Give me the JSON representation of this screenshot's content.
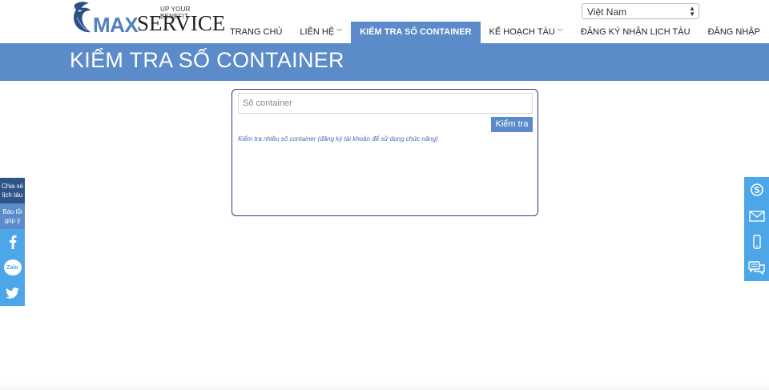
{
  "header": {
    "logo": {
      "tagline": "UP YOUR BENEFIT",
      "brand_max": "MAX",
      "brand_service": "SERVICE"
    },
    "language": {
      "selected": "Việt Nam"
    },
    "nav": [
      {
        "label": "TRANG CHỦ",
        "active": false,
        "dropdown": false
      },
      {
        "label": "LIÊN HỆ",
        "active": false,
        "dropdown": true
      },
      {
        "label": "KIỂM TRA SỐ CONTAINER",
        "active": true,
        "dropdown": false
      },
      {
        "label": "KẾ HOẠCH TÀU",
        "active": false,
        "dropdown": true
      },
      {
        "label": "ĐĂNG KÝ NHẬN LỊCH TÀU",
        "active": false,
        "dropdown": false
      },
      {
        "label": "ĐĂNG NHẬP",
        "active": false,
        "dropdown": false
      }
    ]
  },
  "banner": {
    "title": "KIỂM TRA SỐ CONTAINER"
  },
  "check_form": {
    "input_placeholder": "Số container",
    "input_value": "",
    "button_label": "Kiểm tra",
    "multi_link": "Kiểm tra nhiều số container (đăng ký tài khoản để sử dụng chức năng)"
  },
  "left_bar": {
    "share_label_1": "Chia sẻ",
    "share_label_2": "lịch tàu",
    "report_label_1": "Báo lỗi",
    "report_label_2": "góp ý",
    "icons": [
      "facebook-icon",
      "zalo-icon",
      "twitter-icon"
    ],
    "zalo_text": "Zalo"
  },
  "right_bar": {
    "icons": [
      "skype-icon",
      "mail-icon",
      "phone-icon",
      "chat-icon"
    ]
  },
  "colors": {
    "accent": "#5b8bc9",
    "dark_blue": "#2d5487",
    "light_blue": "#4ca6e8",
    "border_navy": "#2e3b7a"
  }
}
